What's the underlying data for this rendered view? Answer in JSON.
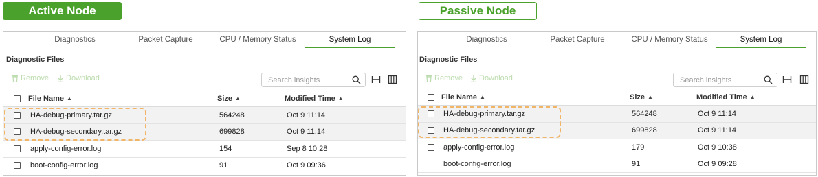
{
  "labels": {
    "active_node": "Active Node",
    "passive_node": "Passive Node"
  },
  "tabs": [
    "Diagnostics",
    "Packet Capture",
    "CPU / Memory Status",
    "System Log"
  ],
  "section_title": "Diagnostic Files",
  "toolbar": {
    "remove_label": "Remove",
    "download_label": "Download",
    "search_placeholder": "Search insights"
  },
  "columns": {
    "file_name": "File Name",
    "size": "Size",
    "modified_time": "Modified Time"
  },
  "colors": {
    "accent_green": "#4aa22c",
    "disabled_green": "#bcdcae",
    "highlight_orange": "#f0b567"
  },
  "active_node": {
    "files": [
      {
        "name": "HA-debug-primary.tar.gz",
        "size": "564248",
        "modified": "Oct 9 11:14"
      },
      {
        "name": "HA-debug-secondary.tar.gz",
        "size": "699828",
        "modified": "Oct 9 11:14"
      },
      {
        "name": "apply-config-error.log",
        "size": "154",
        "modified": "Sep 8 10:28"
      },
      {
        "name": "boot-config-error.log",
        "size": "91",
        "modified": "Oct 9 09:36"
      }
    ]
  },
  "passive_node": {
    "files": [
      {
        "name": "HA-debug-primary.tar.gz",
        "size": "564248",
        "modified": "Oct 9 11:14"
      },
      {
        "name": "HA-debug-secondary.tar.gz",
        "size": "699828",
        "modified": "Oct 9 11:14"
      },
      {
        "name": "apply-config-error.log",
        "size": "179",
        "modified": "Oct 9 10:38"
      },
      {
        "name": "boot-config-error.log",
        "size": "91",
        "modified": "Oct 9 09:28"
      }
    ]
  }
}
